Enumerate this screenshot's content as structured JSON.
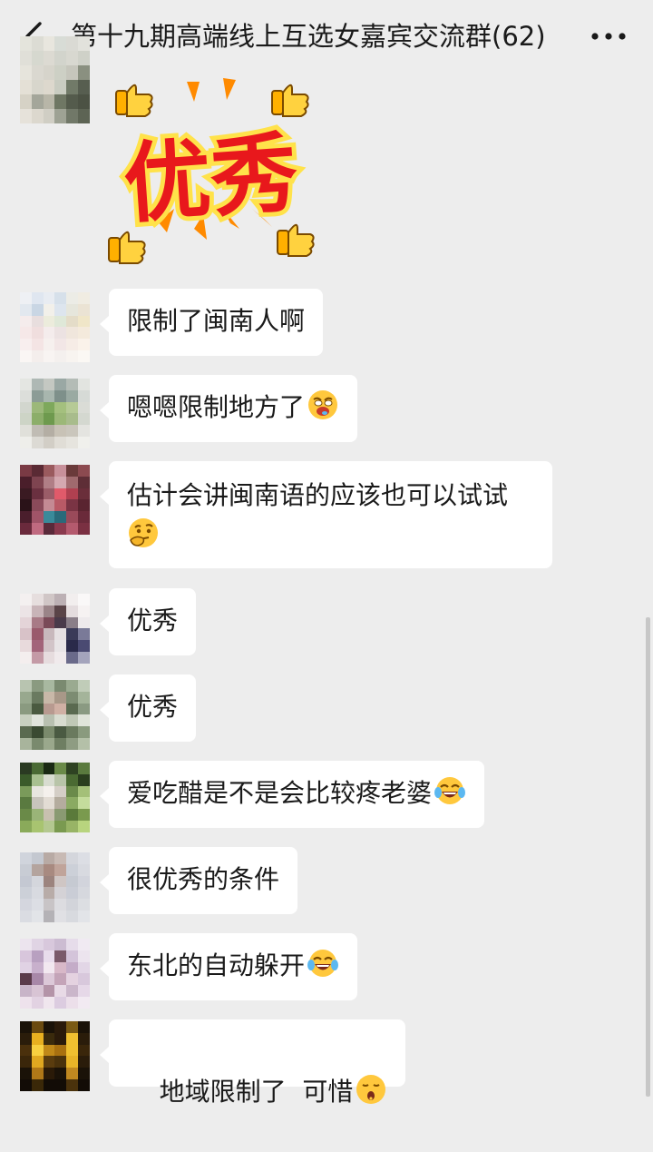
{
  "header": {
    "title": "第十九期高端线上互选女嘉宾交流群(62)",
    "back_icon": "chevron-left-icon",
    "more_icon": "more-dots-icon"
  },
  "sticker": {
    "text": "优秀",
    "icon": "thumbs-up-sticker"
  },
  "messages": [
    {
      "text": "限制了闽南人啊",
      "emoji": ""
    },
    {
      "text": "嗯嗯限制地方了",
      "emoji": "drooling-face-emoji"
    },
    {
      "text": "估计会讲闽南语的应该也可以试试",
      "emoji": "thinking-face-emoji"
    },
    {
      "text": "优秀",
      "emoji": ""
    },
    {
      "text": "优秀",
      "emoji": ""
    },
    {
      "text": "爱吃醋是不是会比较疼老婆",
      "emoji": "tears-of-joy-emoji"
    },
    {
      "text": "很优秀的条件",
      "emoji": ""
    },
    {
      "text": "东北的自动躲开",
      "emoji": "tears-of-joy-emoji"
    },
    {
      "text": "地域限制了  可惜",
      "emoji": "surprised-face-emoji"
    }
  ],
  "colors": {
    "background": "#ededed",
    "bubble": "#ffffff",
    "sticker_text": "#e8181c",
    "sticker_outline": "#ffe24a",
    "emoji_yellow": "#ffc83d"
  }
}
